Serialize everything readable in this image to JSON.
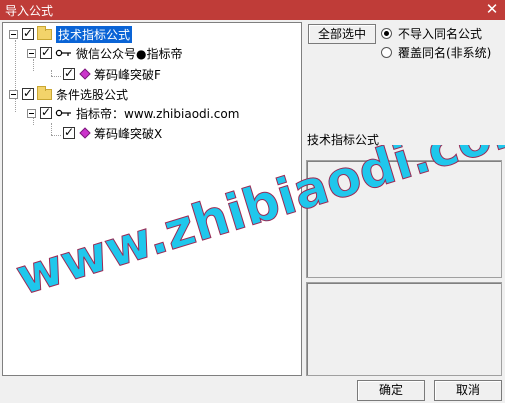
{
  "window": {
    "title": "导入公式",
    "close_glyph": "✕"
  },
  "tree": {
    "root1": {
      "label": "技术指标公式",
      "checked": true
    },
    "child1": {
      "label": "微信公众号●指标帝",
      "checked": true
    },
    "leaf1": {
      "label": "筹码峰突破F",
      "checked": true
    },
    "root2": {
      "label": "条件选股公式",
      "checked": true
    },
    "child2": {
      "label": "指标帝：www.zhibiaodi.com",
      "checked": true
    },
    "leaf2": {
      "label": "筹码峰突破X",
      "checked": true
    }
  },
  "options": {
    "select_all_label": "全部选中",
    "radio_no_import": "不导入同名公式",
    "radio_overwrite": "覆盖同名(非系统)",
    "selected": "radio_no_import"
  },
  "details": {
    "section_label": "技术指标公式"
  },
  "footer": {
    "ok_label": "确定",
    "cancel_label": "取消"
  },
  "watermark": {
    "text": "www.zhibiaodi.com"
  },
  "colors": {
    "titlebar": "#bf3c38",
    "selection": "#0a64d6",
    "watermark": "#1fc7ec"
  }
}
